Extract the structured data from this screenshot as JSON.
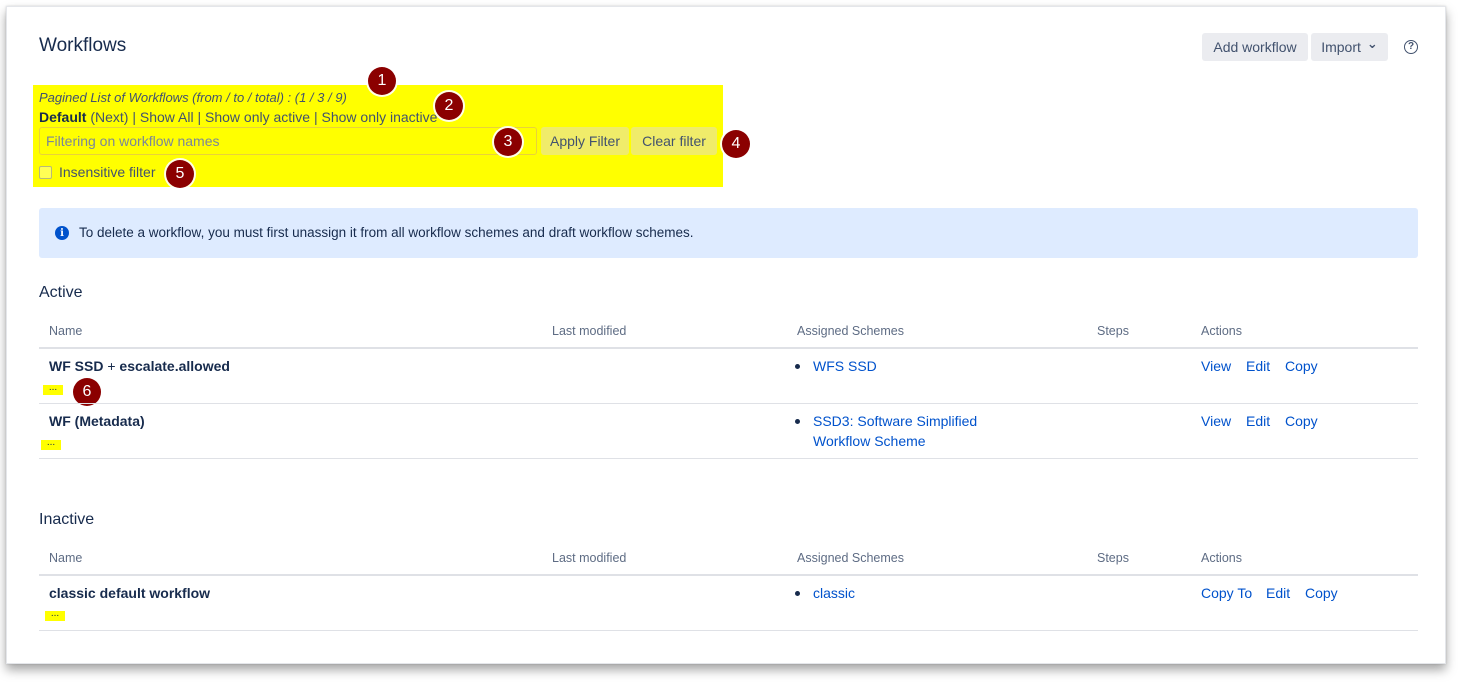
{
  "header": {
    "title": "Workflows",
    "add_workflow": "Add workflow",
    "import": "Import",
    "import_chevron": "⌄",
    "help_symbol": "?"
  },
  "filter": {
    "paged_text": "Pagined List of Workflows (from / to / total) : (1 / 3 / 9)",
    "default_label": "Default",
    "next_label": "(Next)",
    "sep": "|",
    "show_all": "Show All",
    "show_active": "Show only active",
    "show_inactive": "Show only inactive",
    "placeholder": "Filtering on workflow names",
    "apply": "Apply Filter",
    "clear": "Clear filter",
    "insensitive": "Insensitive filter"
  },
  "markers": [
    "1",
    "2",
    "3",
    "4",
    "5",
    "6"
  ],
  "info": {
    "icon": "i",
    "text": "To delete a workflow, you must first unassign it from all workflow schemes and draft workflow schemes."
  },
  "columns": [
    "Name",
    "Last modified",
    "Assigned Schemes",
    "Steps",
    "Actions"
  ],
  "active": {
    "heading": "Active",
    "rows": [
      {
        "name_a": "WF SSD",
        "name_plus": "+",
        "name_b": "escalate.allowed",
        "dots": "...",
        "schemes": "WFS SSD",
        "actions": [
          "View",
          "Edit",
          "Copy"
        ]
      },
      {
        "name": "WF (Metadata)",
        "dots": "...",
        "scheme_line1": "SSD3: Software Simplified",
        "scheme_line2": "Workflow Scheme",
        "actions": [
          "View",
          "Edit",
          "Copy"
        ]
      }
    ]
  },
  "inactive": {
    "heading": "Inactive",
    "rows": [
      {
        "name": "classic default workflow",
        "dots": "...",
        "schemes": "classic",
        "actions": [
          "Copy To",
          "Edit",
          "Copy"
        ]
      }
    ]
  },
  "colors": {
    "highlight": "#ffff00",
    "marker": "#8b0000",
    "link": "#0052cc",
    "info_bg": "#deebff"
  }
}
